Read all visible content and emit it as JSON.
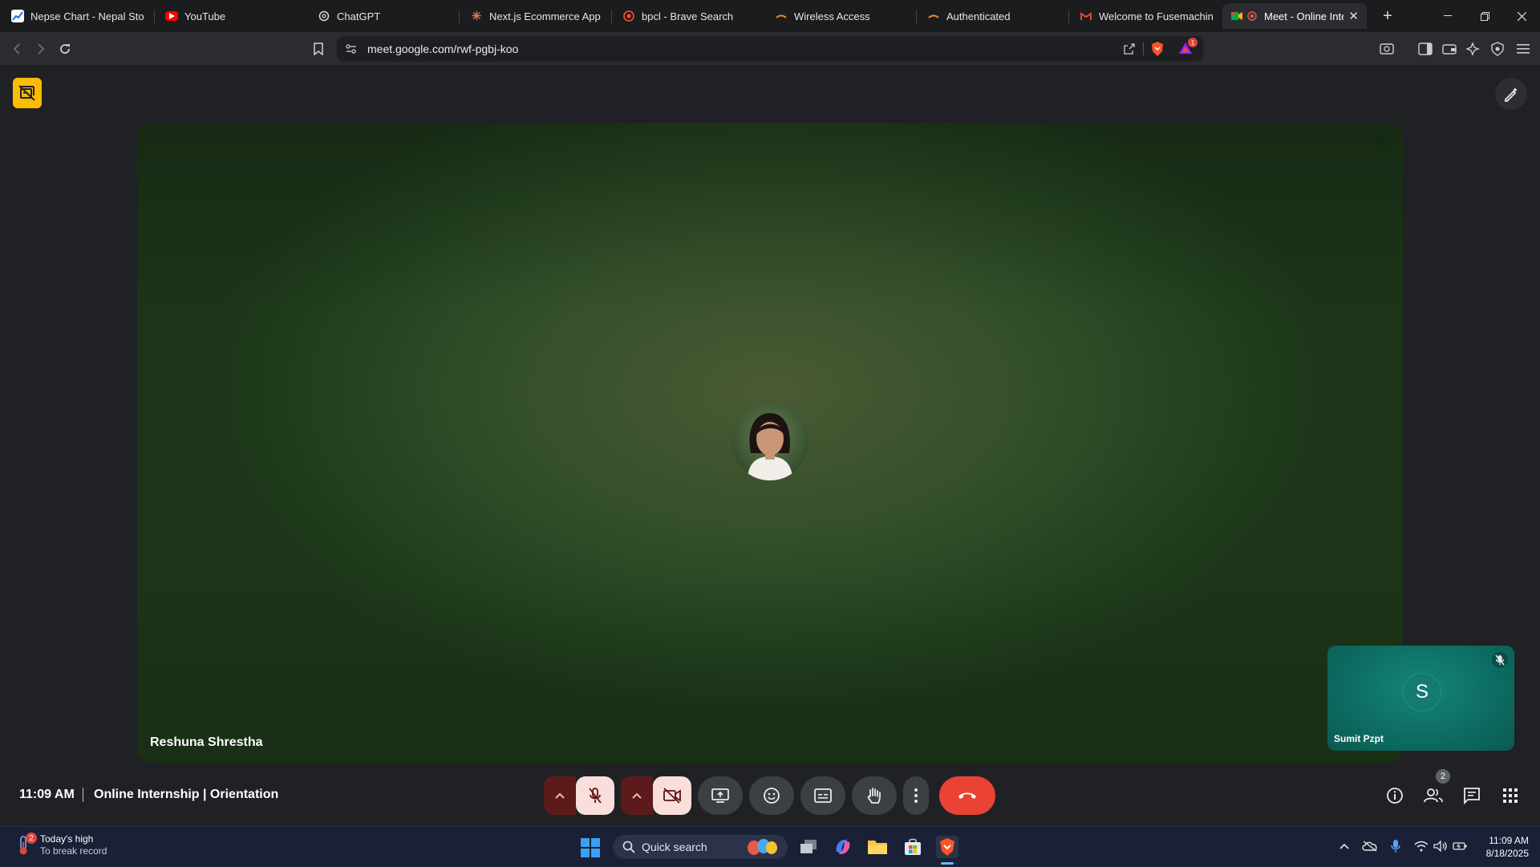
{
  "browser": {
    "tabs": [
      {
        "title": "Nepse Chart - Nepal Stock",
        "icon": "chart-icon"
      },
      {
        "title": "YouTube",
        "icon": "youtube-icon"
      },
      {
        "title": "ChatGPT",
        "icon": "chatgpt-icon"
      },
      {
        "title": "Next.js Ecommerce App D",
        "icon": "claude-icon"
      },
      {
        "title": "bpcl - Brave Search",
        "icon": "brave-search-icon"
      },
      {
        "title": "Wireless Access",
        "icon": "network-icon"
      },
      {
        "title": "Authenticated",
        "icon": "network-icon"
      },
      {
        "title": "Welcome to Fusemachine",
        "icon": "gmail-icon"
      },
      {
        "title": "Meet - Online Inte",
        "icon": "meet-icon",
        "active": true
      }
    ],
    "url": "meet.google.com/rwf-pgbj-koo",
    "shields_badge": "1"
  },
  "meet": {
    "main_participant": "Reshuna Shrestha",
    "self_participant": "Sumit Pzpt",
    "self_initial": "S",
    "time": "11:09 AM",
    "meeting_title": "Online Internship | Orientation",
    "people_count": "2",
    "mic_state": "muted",
    "camera_state": "off",
    "colors": {
      "end_call": "#ea4335",
      "muted_bg": "#f9dedc",
      "self_tile": "#0d6b61",
      "extension": "#fbbc04"
    }
  },
  "taskbar": {
    "weather_line1": "Today's high",
    "weather_line2": "To break record",
    "weather_badge": "2",
    "search_label": "Quick search",
    "time": "11:09 AM",
    "date": "8/18/2025"
  }
}
